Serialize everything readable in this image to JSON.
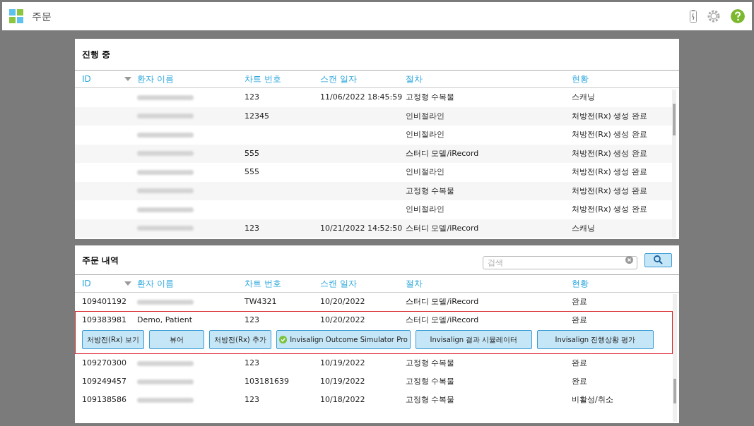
{
  "window": {
    "title": "주문"
  },
  "in_progress": {
    "title": "진행 중",
    "columns": [
      "ID",
      "환자 이름",
      "차트 번호",
      "스캔 일자",
      "절차",
      "현황"
    ],
    "rows": [
      {
        "id": "",
        "name_blurred": true,
        "chart": "123",
        "scan_date": "11/06/2022 18:45:59",
        "procedure": "고정형 수복물",
        "status": "스캐닝"
      },
      {
        "id": "",
        "name_blurred": true,
        "chart": "12345",
        "scan_date": "",
        "procedure": "인비절라인",
        "status": "처방전(Rx) 생성 완료"
      },
      {
        "id": "",
        "name_blurred": true,
        "chart": "",
        "scan_date": "",
        "procedure": "인비절라인",
        "status": "처방전(Rx) 생성 완료"
      },
      {
        "id": "",
        "name_blurred": true,
        "chart": "555",
        "scan_date": "",
        "procedure": "스터디 모델/iRecord",
        "status": "처방전(Rx) 생성 완료"
      },
      {
        "id": "",
        "name_blurred": true,
        "chart": "555",
        "scan_date": "",
        "procedure": "인비절라인",
        "status": "처방전(Rx) 생성 완료"
      },
      {
        "id": "",
        "name_blurred": true,
        "chart": "",
        "scan_date": "",
        "procedure": "고정형 수복물",
        "status": "처방전(Rx) 생성 완료"
      },
      {
        "id": "",
        "name_blurred": true,
        "chart": "",
        "scan_date": "",
        "procedure": "인비절라인",
        "status": "처방전(Rx) 생성 완료"
      },
      {
        "id": "",
        "name_blurred": true,
        "chart": "123",
        "scan_date": "10/21/2022 14:52:50",
        "procedure": "스터디 모델/iRecord",
        "status": "스캐닝"
      }
    ]
  },
  "history": {
    "title": "주문 내역",
    "search": {
      "placeholder": "검색"
    },
    "columns": [
      "ID",
      "환자 이름",
      "차트 번호",
      "스캔 일자",
      "절차",
      "현황"
    ],
    "rows": [
      {
        "id": "109401192",
        "name_blurred": true,
        "chart": "TW4321",
        "scan_date": "10/20/2022",
        "procedure": "스터디 모델/iRecord",
        "status": "완료",
        "selected": false
      },
      {
        "id": "109383981",
        "name": "Demo, Patient",
        "chart": "123",
        "scan_date": "10/20/2022",
        "procedure": "스터디 모델/iRecord",
        "status": "완료",
        "selected": true,
        "actions": [
          {
            "label": "처방전(Rx) 보기",
            "checked": false
          },
          {
            "label": "뷰어",
            "checked": false
          },
          {
            "label": "처방전(Rx) 추가",
            "checked": false
          },
          {
            "label": "Invisalign Outcome Simulator Pro",
            "checked": true
          },
          {
            "label": "Invisalign 결과 시뮬레이터",
            "checked": false
          },
          {
            "label": "Invisalign 진행상황 평가",
            "checked": false
          }
        ]
      },
      {
        "id": "109270300",
        "name_blurred": true,
        "chart": "123",
        "scan_date": "10/19/2022",
        "procedure": "고정형 수복물",
        "status": "완료",
        "selected": false
      },
      {
        "id": "109249457",
        "name_blurred": true,
        "chart": "103181639",
        "scan_date": "10/19/2022",
        "procedure": "고정형 수복물",
        "status": "완료",
        "selected": false
      },
      {
        "id": "109138586",
        "name_blurred": true,
        "chart": "123",
        "scan_date": "10/18/2022",
        "procedure": "고정형 수복물",
        "status": "비활성/취소",
        "selected": false
      }
    ]
  }
}
